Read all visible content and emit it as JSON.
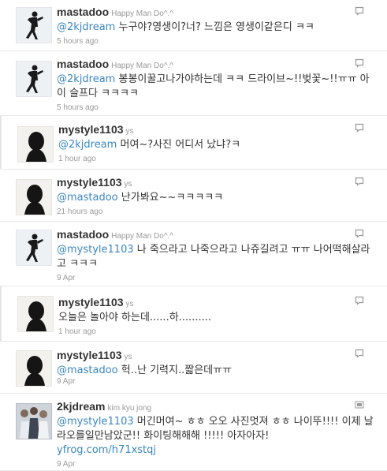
{
  "tweets": [
    {
      "username": "mastadoo",
      "fullname": "Happy Man Do^.^",
      "mention": "@2kjdream",
      "body": " 누구야?영생이?너? 느낌은 영생이같은디 ㅋㅋ",
      "time": "5 hours ago",
      "avatar": "moonwalk-silhouette-avatar",
      "action": "reply-icon"
    },
    {
      "username": "mastadoo",
      "fullname": "Happy Man Do^.^",
      "mention": "@2kjdream",
      "body": " 봉봉이꿀고나가야하는데 ㅋㅋ 드라이브~!!벚꽃~!!ㅠㅠ 아이 슬프다 ㅋㅋㅋㅋ",
      "time": "5 hours ago",
      "avatar": "moonwalk-silhouette-avatar",
      "action": "reply-icon"
    },
    {
      "username": "mystyle1103",
      "fullname": "ys",
      "mention": "@2kjdream",
      "body": " 머여~?사진 어디서 났냐?ㅋ",
      "time": "1 hour ago",
      "avatar": "dark-silhouette-avatar",
      "action": "reply-icon"
    },
    {
      "username": "mystyle1103",
      "fullname": "ys",
      "mention": "@mastadoo",
      "body": " 난가봐요~~ㅋㅋㅋㅋㅋ",
      "time": "21 hours ago",
      "avatar": "dark-silhouette-avatar",
      "action": "reply-icon"
    },
    {
      "username": "mastadoo",
      "fullname": "Happy Man Do^.^",
      "mention": "@mystyle1103",
      "body": " 나 죽으라고 나죽으라고 나쥬길려고 ㅠㅠ 나어떡해살라고 ㅋㅋㅋ",
      "time": "9 Apr",
      "avatar": "moonwalk-silhouette-avatar",
      "action": "reply-icon"
    },
    {
      "username": "mystyle1103",
      "fullname": "ys",
      "mention": "",
      "body": "오늘은 놀아야 하는데......하..........",
      "time": "1 hour ago",
      "avatar": "dark-silhouette-avatar",
      "action": "reply-icon"
    },
    {
      "username": "mystyle1103",
      "fullname": "ys",
      "mention": "@mastadoo",
      "body": " 헉..난 기력지..짧은데ㅠㅠ",
      "time": "9 Apr",
      "avatar": "dark-silhouette-avatar",
      "action": "reply-icon"
    },
    {
      "username": "2kjdream",
      "fullname": "kim kyu jong",
      "mention": "@mystyle1103",
      "body": " 머긴머여~ ㅎㅎ 오오 사진멋져 ㅎㅎ 나이뚜!!!! 이제 날라오를일만남았군!! 화이팅해해해 !!!!! 아자아자!",
      "link": "yfrog.com/h71xstqj",
      "time": "9 Apr",
      "avatar": "group-photo-avatar",
      "action": "delete-icon"
    }
  ],
  "colors": {
    "link": "#3a86c4",
    "username": "#333333",
    "meta": "#999999"
  }
}
